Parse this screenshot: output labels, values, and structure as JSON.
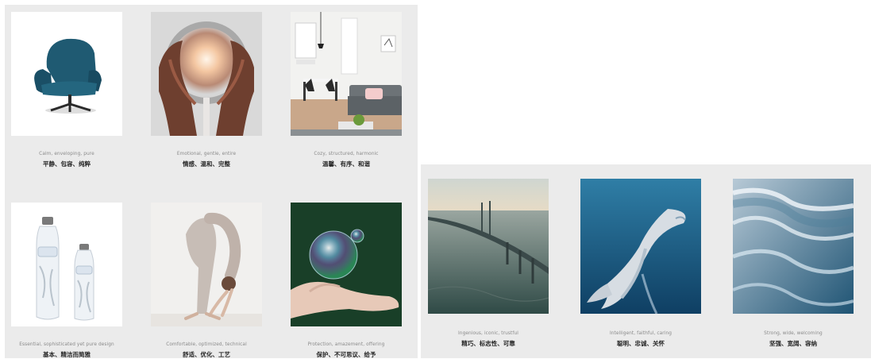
{
  "left_board": {
    "cards": [
      {
        "image": "teal-armchair-image",
        "en": "Calm, enveloping, pure",
        "zh": "平静、包容、纯粹"
      },
      {
        "image": "hands-holding-glowing-orb-image",
        "en": "Emotional, gentle, entire",
        "zh": "情感、温和、完整"
      },
      {
        "image": "cozy-living-room-image",
        "en": "Cozy, structured, harmonic",
        "zh": "温馨、有序、和谐"
      },
      {
        "image": "water-bottles-image",
        "en": "Essential, sophisticated yet pure design",
        "zh": "基本、精洁而简雅"
      },
      {
        "image": "yoga-stretch-image",
        "en": "Comfortable, optimized, technical",
        "zh": "舒适、优化、工艺"
      },
      {
        "image": "hand-with-soap-bubble-image",
        "en": "Protection, amazement, offering",
        "zh": "保护、不可思议、给予"
      }
    ]
  },
  "right_board": {
    "cards": [
      {
        "image": "sea-bridge-image",
        "en": "Ingenious, iconic, trustful",
        "zh": "精巧、标志性、可靠"
      },
      {
        "image": "dolphin-image",
        "en": "Intelligent, faithful, caring",
        "zh": "聪明、忠诚、关怀"
      },
      {
        "image": "ocean-waves-image",
        "en": "Strong, wide, welcoming",
        "zh": "坚强、宽阔、容纳"
      }
    ]
  }
}
